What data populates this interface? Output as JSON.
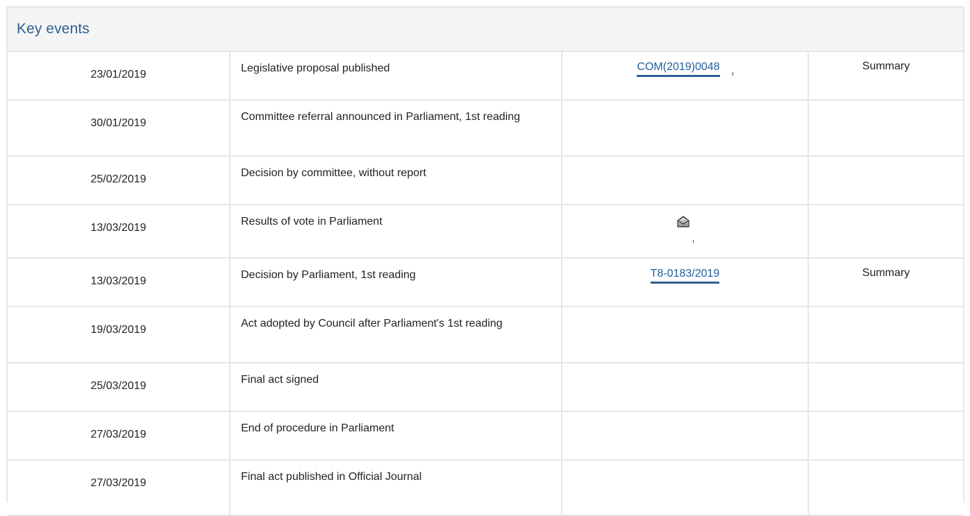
{
  "panel": {
    "title": "Key events"
  },
  "rows": [
    {
      "date": "23/01/2019",
      "event": "Legislative proposal published",
      "ref": "COM(2019)0048",
      "summary": "Summary"
    },
    {
      "date": "30/01/2019",
      "event": "Committee referral announced in Parliament, 1st reading",
      "ref": "",
      "summary": ""
    },
    {
      "date": "25/02/2019",
      "event": "Decision by committee, without report",
      "ref": "",
      "summary": ""
    },
    {
      "date": "13/03/2019",
      "event": "Results of vote in Parliament",
      "ref_icon": "ballot-box-icon",
      "ref": "",
      "summary": ""
    },
    {
      "date": "13/03/2019",
      "event": "Decision by Parliament, 1st reading",
      "ref": "T8-0183/2019",
      "summary": "Summary"
    },
    {
      "date": "19/03/2019",
      "event": "Act adopted by Council after Parliament's 1st reading",
      "ref": "",
      "summary": ""
    },
    {
      "date": "25/03/2019",
      "event": "Final act signed",
      "ref": "",
      "summary": ""
    },
    {
      "date": "27/03/2019",
      "event": "End of procedure in Parliament",
      "ref": "",
      "summary": ""
    },
    {
      "date": "27/03/2019",
      "event": "Final act published in Official Journal",
      "ref": "",
      "summary": ""
    }
  ],
  "colors": {
    "title": "#2f5f8e",
    "link": "#1f5e99",
    "border": "#e6e6e6",
    "header_bg": "#f5f5f5"
  }
}
